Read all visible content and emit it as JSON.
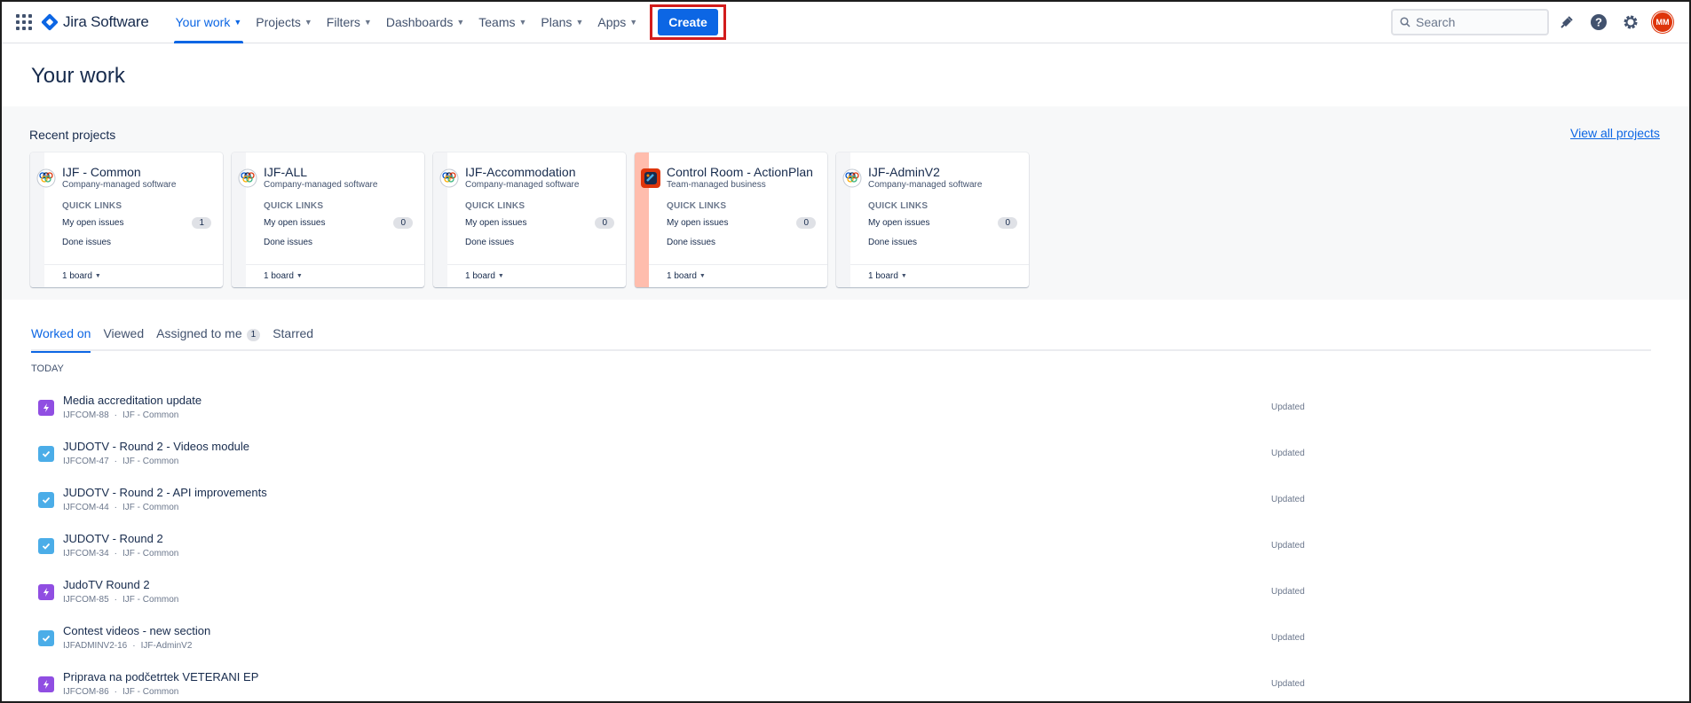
{
  "app": {
    "name": "Jira Software"
  },
  "nav": {
    "items": [
      {
        "label": "Your work",
        "active": true
      },
      {
        "label": "Projects"
      },
      {
        "label": "Filters"
      },
      {
        "label": "Dashboards"
      },
      {
        "label": "Teams"
      },
      {
        "label": "Plans"
      },
      {
        "label": "Apps"
      }
    ],
    "create_label": "Create",
    "search_placeholder": "Search",
    "avatar_initials": "MM"
  },
  "page": {
    "title": "Your work",
    "recent_title": "Recent projects",
    "view_all": "View all projects"
  },
  "projects": [
    {
      "name": "IJF - Common",
      "type": "Company-managed software",
      "quick_links": "QUICK LINKS",
      "open_label": "My open issues",
      "open_count": "1",
      "done_label": "Done issues",
      "boards": "1 board",
      "stripe": "#f4f5f7",
      "icon": "ijf-logo-icon"
    },
    {
      "name": "IJF-ALL",
      "type": "Company-managed software",
      "quick_links": "QUICK LINKS",
      "open_label": "My open issues",
      "open_count": "0",
      "done_label": "Done issues",
      "boards": "1 board",
      "stripe": "#f4f5f7",
      "icon": "ijf-logo-icon"
    },
    {
      "name": "IJF-Accommodation",
      "type": "Company-managed software",
      "quick_links": "QUICK LINKS",
      "open_label": "My open issues",
      "open_count": "0",
      "done_label": "Done issues",
      "boards": "1 board",
      "stripe": "#f4f5f7",
      "icon": "ijf-logo-icon"
    },
    {
      "name": "Control Room - ActionPlan",
      "type": "Team-managed business",
      "quick_links": "QUICK LINKS",
      "open_label": "My open issues",
      "open_count": "0",
      "done_label": "Done issues",
      "boards": "1 board",
      "stripe": "#ffbdad",
      "icon": "control-room-icon"
    },
    {
      "name": "IJF-AdminV2",
      "type": "Company-managed software",
      "quick_links": "QUICK LINKS",
      "open_label": "My open issues",
      "open_count": "0",
      "done_label": "Done issues",
      "boards": "1 board",
      "stripe": "#f4f5f7",
      "icon": "ijf-logo-icon"
    }
  ],
  "tabs": [
    {
      "label": "Worked on",
      "active": true
    },
    {
      "label": "Viewed"
    },
    {
      "label": "Assigned to me",
      "badge": "1"
    },
    {
      "label": "Starred"
    }
  ],
  "section_label": "TODAY",
  "issues": [
    {
      "title": "Media accreditation update",
      "key": "IJFCOM-88",
      "project": "IJF - Common",
      "status": "Updated",
      "type": "epic"
    },
    {
      "title": "JUDOTV - Round 2 - Videos module",
      "key": "IJFCOM-47",
      "project": "IJF - Common",
      "status": "Updated",
      "type": "task"
    },
    {
      "title": "JUDOTV - Round 2 - API improvements",
      "key": "IJFCOM-44",
      "project": "IJF - Common",
      "status": "Updated",
      "type": "task"
    },
    {
      "title": "JUDOTV - Round 2",
      "key": "IJFCOM-34",
      "project": "IJF - Common",
      "status": "Updated",
      "type": "task"
    },
    {
      "title": "JudoTV Round 2",
      "key": "IJFCOM-85",
      "project": "IJF - Common",
      "status": "Updated",
      "type": "epic"
    },
    {
      "title": "Contest videos - new section",
      "key": "IJFADMINV2-16",
      "project": "IJF-AdminV2",
      "status": "Updated",
      "type": "task"
    },
    {
      "title": "Priprava na podčetrtek VETERANI EP",
      "key": "IJFCOM-86",
      "project": "IJF - Common",
      "status": "Updated",
      "type": "epic"
    }
  ],
  "colors": {
    "accent": "#0c66e4",
    "epic": "#904ee2",
    "task": "#4bade8",
    "highlight": "#d21c1c"
  }
}
